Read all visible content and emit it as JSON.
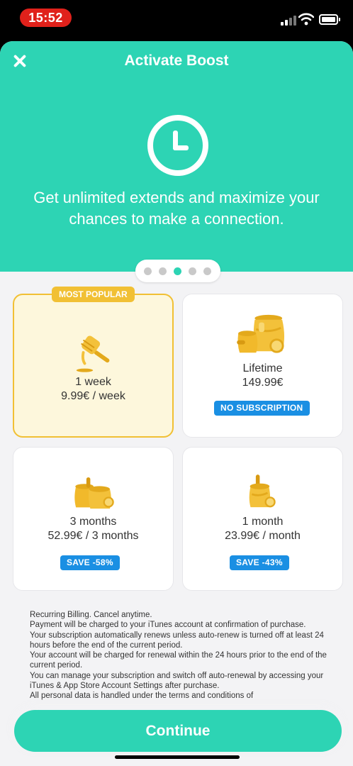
{
  "status_bar": {
    "time": "15:52"
  },
  "header": {
    "title": "Activate Boost",
    "close_icon": "close-icon"
  },
  "hero": {
    "icon": "clock-icon",
    "tagline": "Get unlimited extends and maximize your chances to make a connection."
  },
  "pager": {
    "count": 5,
    "active_index": 2
  },
  "plans": [
    {
      "ribbon": "MOST POPULAR",
      "line1": "1 week",
      "line2": "9.99€ / week",
      "badge": "",
      "selected": true,
      "icon": "honey-dipper-icon"
    },
    {
      "ribbon": "",
      "line1": "Lifetime",
      "line2": "149.99€",
      "badge": "NO SUBSCRIPTION",
      "selected": false,
      "icon": "honey-jars-large-icon"
    },
    {
      "ribbon": "",
      "line1": "3 months",
      "line2": "52.99€ / 3 months",
      "badge": "SAVE -58%",
      "selected": false,
      "icon": "honey-jars-medium-icon"
    },
    {
      "ribbon": "",
      "line1": "1 month",
      "line2": "23.99€ / month",
      "badge": "SAVE -43%",
      "selected": false,
      "icon": "honey-jar-small-icon"
    }
  ],
  "legal": [
    "Recurring Billing. Cancel anytime.",
    "Payment will be charged to your iTunes account at confirmation of purchase.",
    "Your subscription automatically renews unless auto-renew is turned off at least 24 hours before the end of the current period.",
    "Your account will be charged for renewal within the 24 hours prior to the end of the current period.",
    "You can manage your subscription and switch off auto-renewal by accessing your iTunes & App Store Account Settings after purchase.",
    "All personal data is handled under the terms and conditions of"
  ],
  "continue_label": "Continue",
  "colors": {
    "accent": "#2dd4b4",
    "gold": "#f1c034",
    "badge_blue": "#1a8fe3",
    "time_pill": "#e0211b"
  }
}
